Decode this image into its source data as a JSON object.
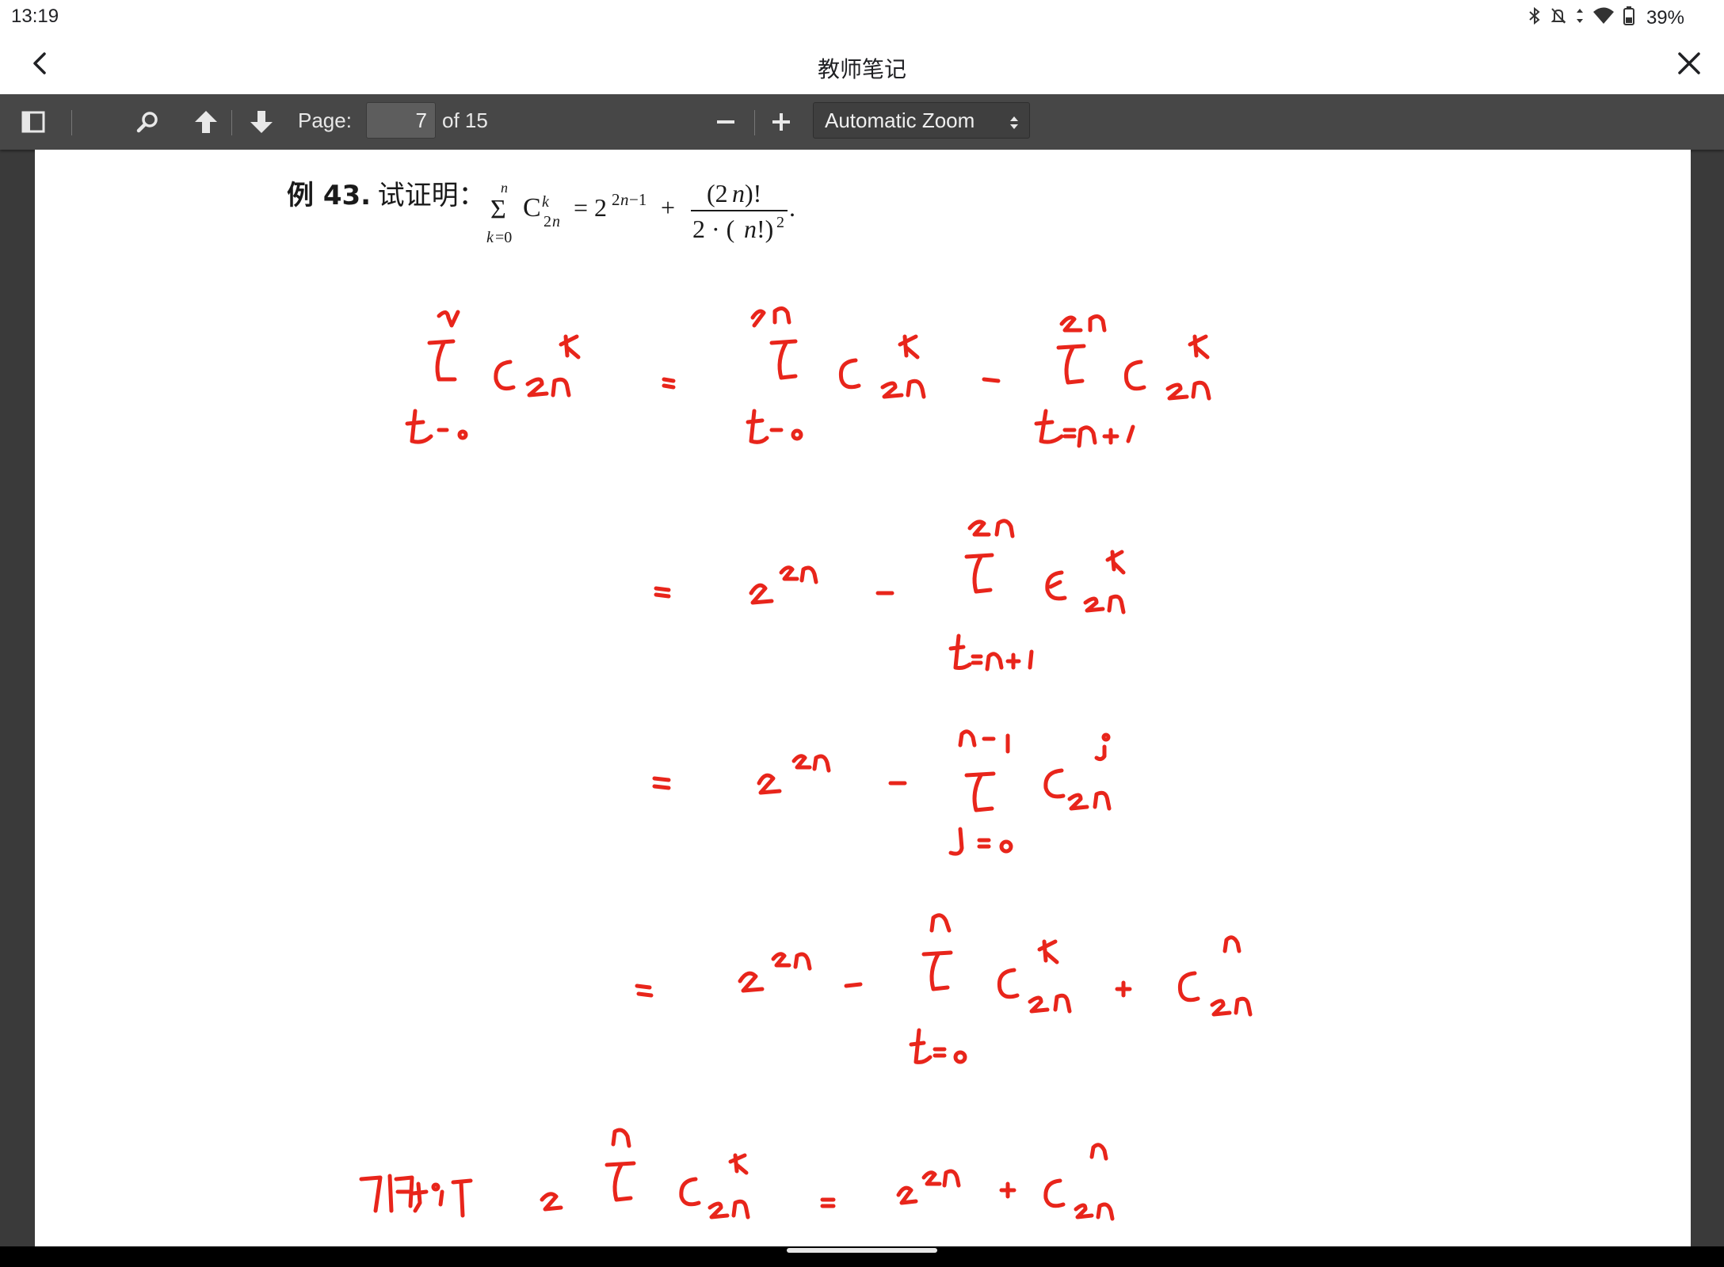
{
  "status_bar": {
    "time": "13:19",
    "battery": "39%"
  },
  "app_bar": {
    "title": "教师笔记"
  },
  "toolbar": {
    "page_label": "Page:",
    "page_number": "7",
    "page_count": "of 15",
    "zoom_value": "Automatic Zoom"
  },
  "document": {
    "problem": {
      "label": "例 43.",
      "prompt": "试证明："
    }
  },
  "colors": {
    "ink": "#e8251b",
    "toolbar": "#474747",
    "background": "#3a3a3a"
  }
}
